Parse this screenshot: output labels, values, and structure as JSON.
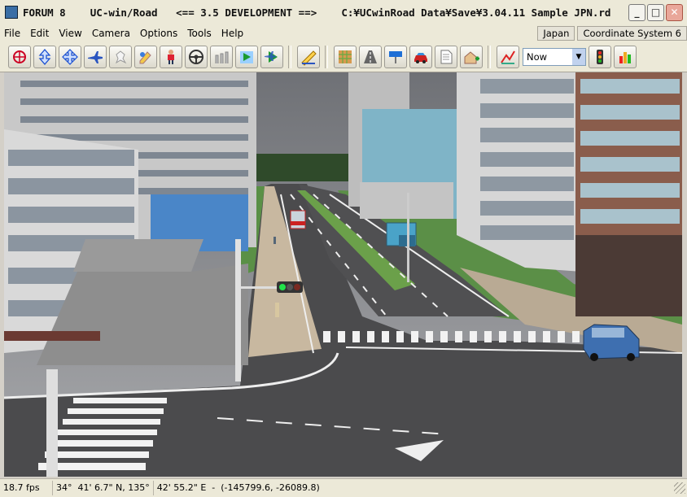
{
  "window": {
    "title": "FORUM 8    UC-win/Road   <== 3.5 DEVELOPMENT ==>    C:¥UCwinRoad Data¥Save¥3.04.11 Sample JPN.rd",
    "minimize": "_",
    "maximize": "□",
    "close": "✕"
  },
  "menu": {
    "items": [
      "File",
      "Edit",
      "View",
      "Camera",
      "Options",
      "Tools",
      "Help"
    ],
    "region": "Japan",
    "coordinate_system": "Coordinate System 6"
  },
  "toolbar": {
    "icons": [
      "rotate-view-icon",
      "vertical-move-icon",
      "pan-move-icon",
      "fly-mode-icon",
      "walk-mode-icon",
      "edit-object-icon",
      "pedestrian-icon",
      "steering-wheel-icon",
      "road-crane-icon",
      "drive-route-icon",
      "flight-path-icon",
      "measure-ruler-icon",
      "terrain-grid-icon",
      "road-section-icon",
      "road-sign-icon",
      "car-model-icon",
      "document-icon",
      "house-add-icon",
      "graph-icon",
      "traffic-light-icon",
      "bar-chart-icon"
    ],
    "time_select": "Now"
  },
  "status": {
    "fps": "18.7 fps",
    "latitude": "34°  41' 6.7\" N, 135°",
    "longitude": "42' 55.2\" E  -  (-145799.6, -26089.8)"
  }
}
